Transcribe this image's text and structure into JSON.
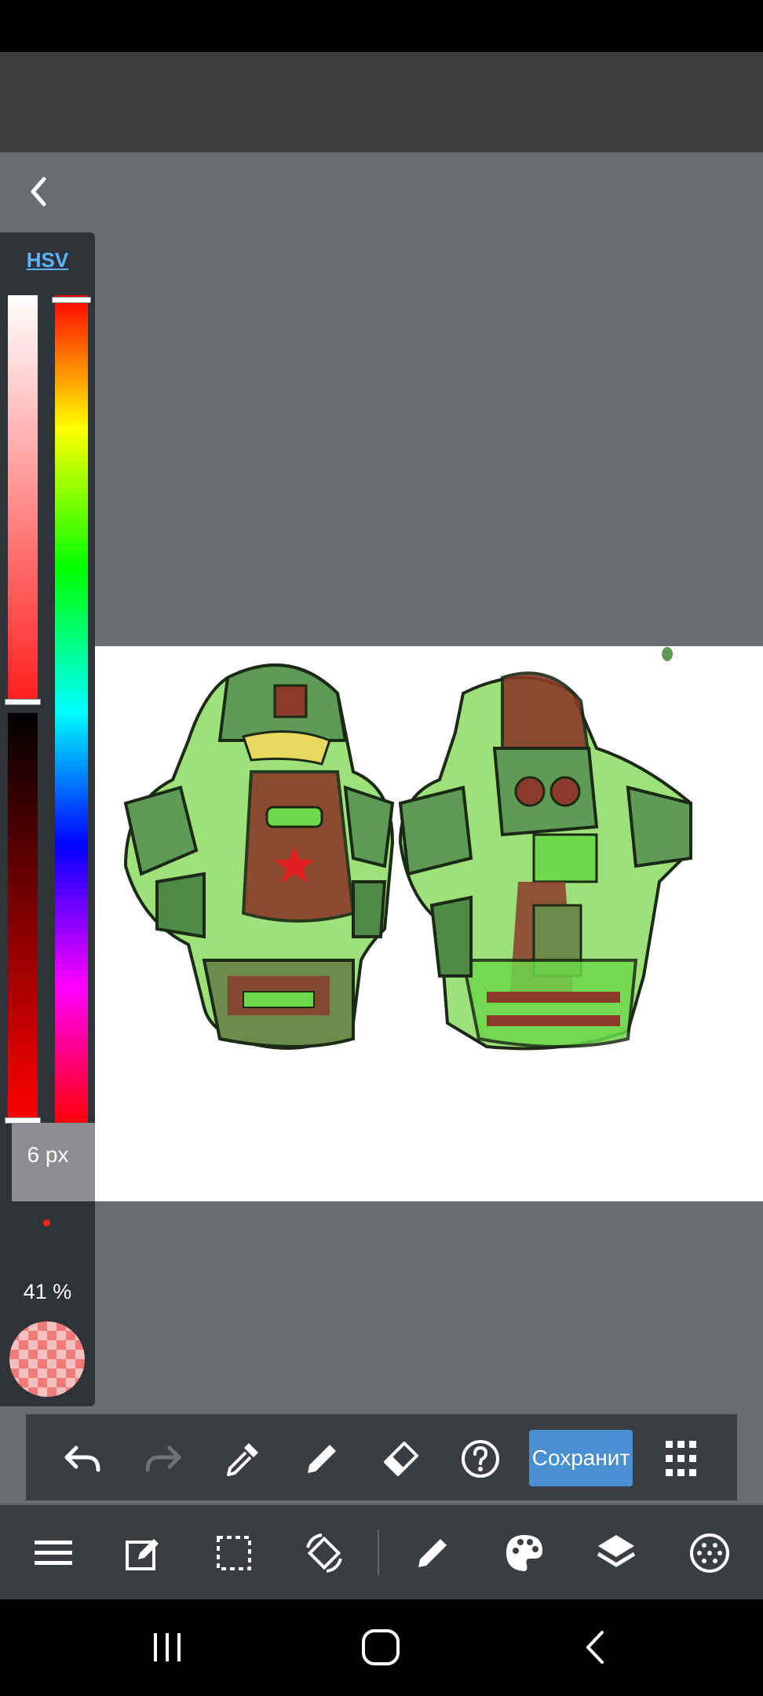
{
  "color_panel": {
    "mode_label": "HSV",
    "brush_size": "6 px",
    "opacity": "41 %"
  },
  "toolbar": {
    "save_label": "Сохранит",
    "items": [
      "undo-icon",
      "redo-icon",
      "eyedropper-icon",
      "pen-icon",
      "eraser-icon",
      "help-icon",
      "save-button",
      "grid-menu-icon"
    ]
  },
  "bottom_nav": {
    "items": [
      "menu-icon",
      "edit-icon",
      "selection-icon",
      "transform-icon",
      "brush-icon",
      "palette-icon",
      "layers-icon",
      "material-icon"
    ]
  },
  "colors": {
    "accent": "#4a8fcf",
    "current_color": "#ff1d1d",
    "panel_bg": "#2f3236"
  }
}
